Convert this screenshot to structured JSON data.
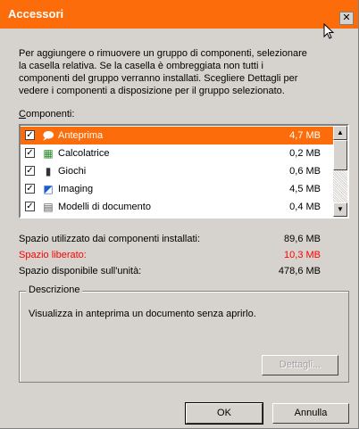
{
  "window": {
    "title": "Accessori",
    "close_glyph": "✕"
  },
  "intro_text": "Per aggiungere o rimuovere un gruppo di componenti, selezionare\nla casella relativa. Se la casella è ombreggiata non tutti i\ncomponenti del gruppo verranno installati. Scegliere Dettagli per\nvedere i componenti a disposizione per il gruppo selezionato.",
  "components_label": {
    "accel": "C",
    "rest": "omponenti:"
  },
  "components": [
    {
      "name": "Anteprima",
      "size": "4,7 MB",
      "checked": "✓",
      "icon": "🗩",
      "selected": true
    },
    {
      "name": "Calcolatrice",
      "size": "0,2 MB",
      "checked": "✓",
      "icon": "▦"
    },
    {
      "name": "Giochi",
      "size": "0,6 MB",
      "checked": "✓",
      "icon": "▮"
    },
    {
      "name": "Imaging",
      "size": "4,5 MB",
      "checked": "✓",
      "icon": "◩"
    },
    {
      "name": "Modelli di documento",
      "size": "0,4 MB",
      "checked": "✓",
      "icon": "▤"
    }
  ],
  "space": {
    "used_label": "Spazio utilizzato dai componenti installati:",
    "used_value": "89,6 MB",
    "freed_label": "Spazio liberato:",
    "freed_value": "10,3 MB",
    "available_label": "Spazio disponibile sull'unità:",
    "available_value": "478,6 MB"
  },
  "description": {
    "title": "Descrizione",
    "text": "Visualizza in anteprima un documento senza aprirlo."
  },
  "buttons": {
    "details": "Dettagli...",
    "ok": "OK",
    "cancel": "Annulla"
  },
  "colors": {
    "selection": "#fd6c0a",
    "title_bar": "#fd6c0a",
    "freed_text": "#ff0000",
    "dialog_bg": "#d6d3ce"
  }
}
